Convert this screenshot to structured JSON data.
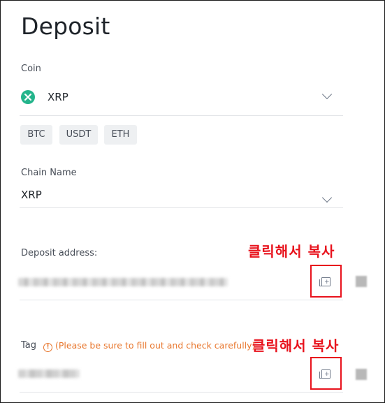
{
  "page": {
    "title": "Deposit"
  },
  "coin": {
    "label": "Coin",
    "selected": "XRP",
    "icon": "xrp-coin-icon",
    "chips": [
      "BTC",
      "USDT",
      "ETH"
    ]
  },
  "chain": {
    "label": "Chain Name",
    "selected": "XRP"
  },
  "address": {
    "label": "Deposit address:",
    "copy_icon": "copy-icon"
  },
  "tag": {
    "label": "Tag",
    "warning": "(Please be sure to fill out and check carefully)",
    "warning_icon": "info-circle-icon",
    "copy_icon": "copy-icon"
  },
  "annotations": {
    "copy_hint": "클릭해서 복사"
  },
  "colors": {
    "accent_red": "#e8121c",
    "warning_orange": "#e8772e",
    "xrp_green": "#23b48b"
  }
}
